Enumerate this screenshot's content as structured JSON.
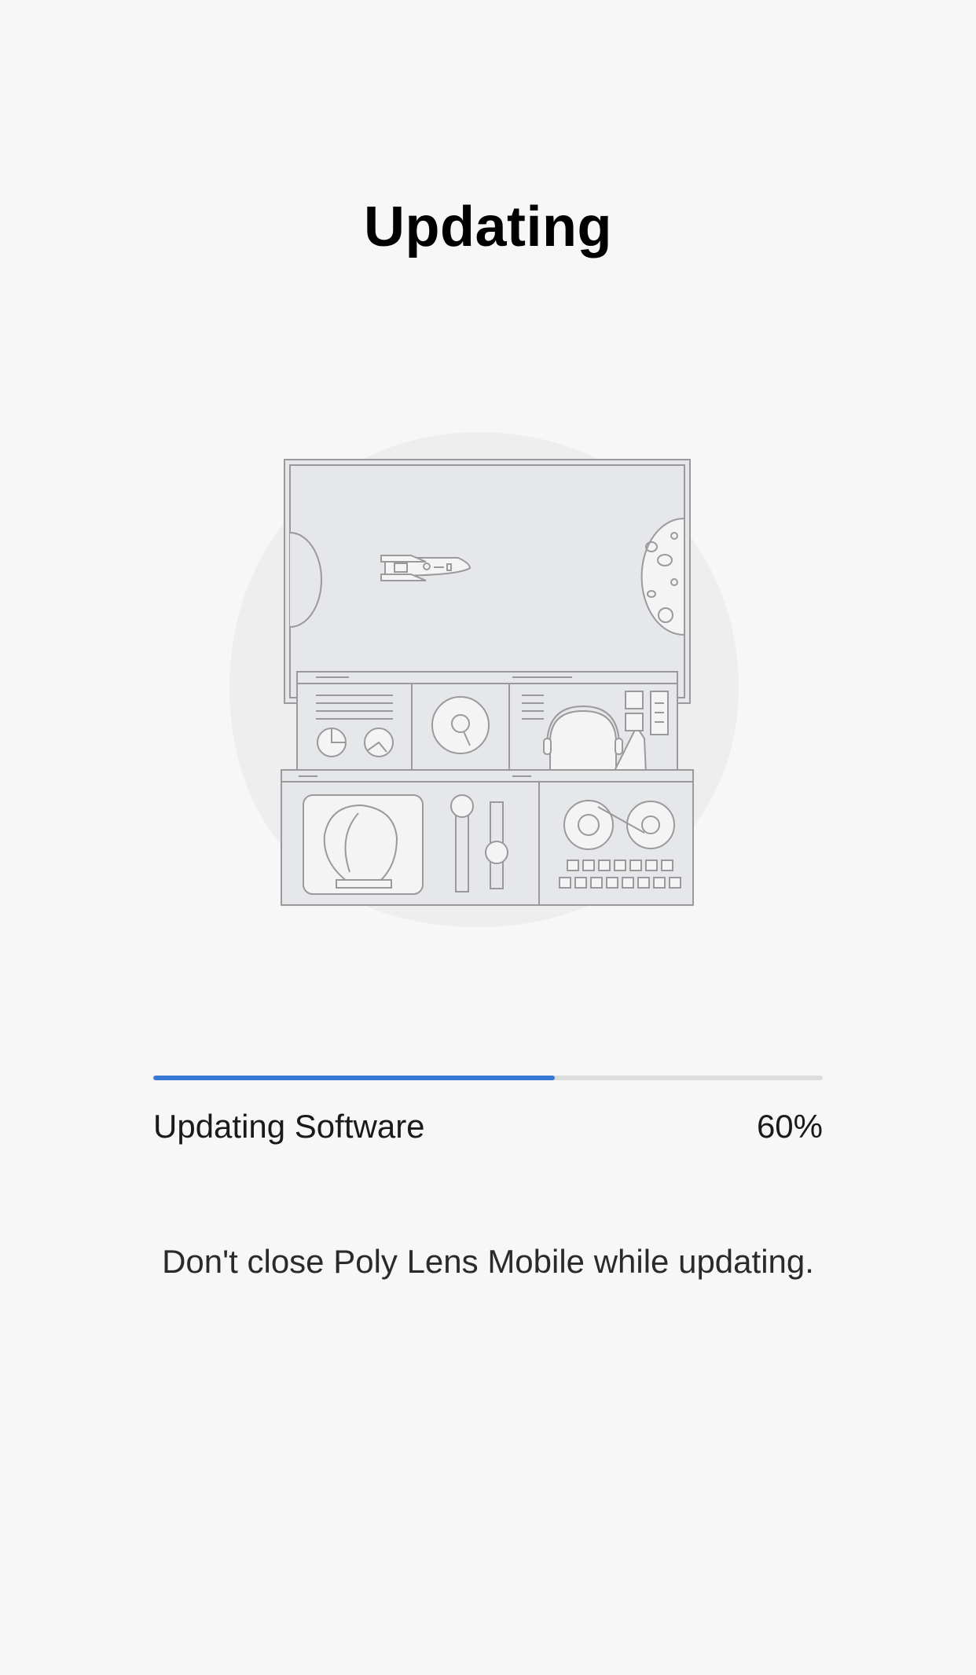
{
  "header": {
    "title": "Updating"
  },
  "progress": {
    "label": "Updating Software",
    "percent_text": "60%",
    "value_fraction": 0.6,
    "fill_color": "#3a78d8",
    "track_color": "#dcdcdc"
  },
  "message": "Don't close Poly Lens Mobile while updating.",
  "illustration": {
    "icon": "mission-control-space-icon"
  }
}
